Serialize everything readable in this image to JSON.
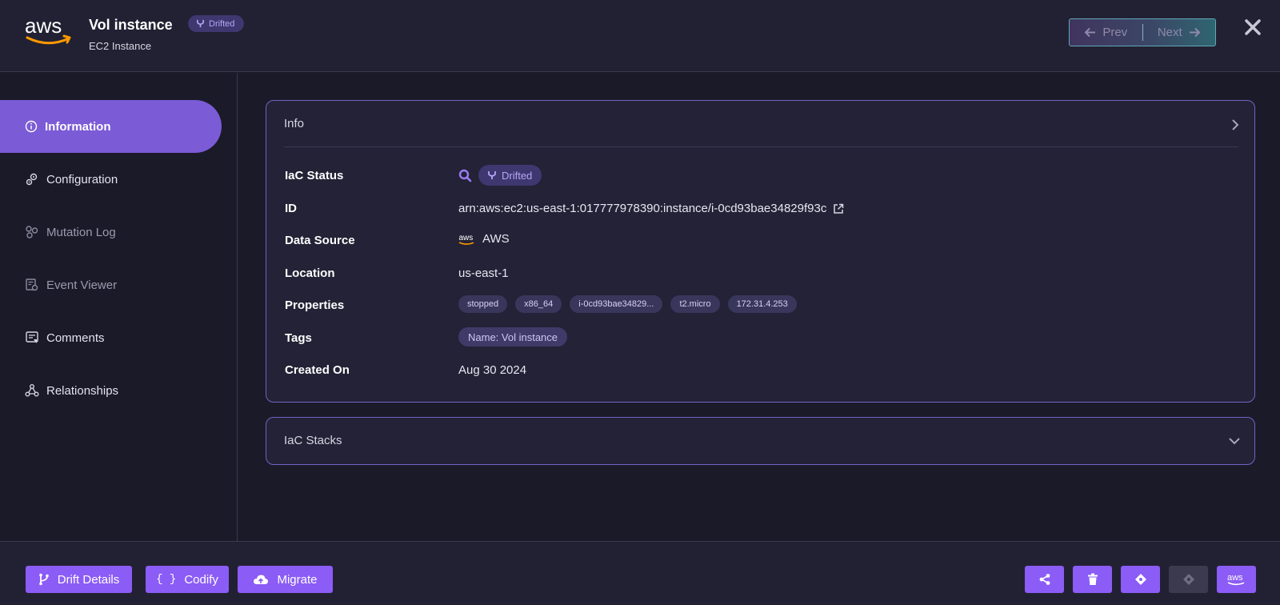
{
  "header": {
    "logo_text": "aws",
    "title": "Vol instance",
    "status_badge": "Drifted",
    "subtitle": "EC2 Instance",
    "prev_label": "Prev",
    "next_label": "Next",
    "close_icon": "close-icon"
  },
  "sidebar": {
    "items": [
      {
        "label": "Information",
        "icon": "info-icon",
        "state": "active"
      },
      {
        "label": "Configuration",
        "icon": "gears-icon",
        "state": "normal"
      },
      {
        "label": "Mutation Log",
        "icon": "mutation-log-icon",
        "state": "disabled"
      },
      {
        "label": "Event Viewer",
        "icon": "event-viewer-icon",
        "state": "disabled"
      },
      {
        "label": "Comments",
        "icon": "comments-icon",
        "state": "normal"
      },
      {
        "label": "Relationships",
        "icon": "relationships-icon",
        "state": "normal"
      }
    ]
  },
  "info": {
    "heading": "Info",
    "rows": {
      "iac_status": {
        "label": "IaC Status",
        "value": "Drifted"
      },
      "id": {
        "label": "ID",
        "value": "arn:aws:ec2:us-east-1:017777978390:instance/i-0cd93bae34829f93c"
      },
      "data_source": {
        "label": "Data Source",
        "logo_text": "aws",
        "value": "AWS"
      },
      "location": {
        "label": "Location",
        "value": "us-east-1"
      },
      "properties": {
        "label": "Properties",
        "values": [
          "stopped",
          "x86_64",
          "i-0cd93bae34829...",
          "t2.micro",
          "172.31.4.253"
        ]
      },
      "tags": {
        "label": "Tags",
        "values": [
          "Name: Vol instance"
        ]
      },
      "created_on": {
        "label": "Created On",
        "value": "Aug 30 2024"
      }
    }
  },
  "stacks": {
    "heading": "IaC Stacks"
  },
  "footer": {
    "drift_details": "Drift Details",
    "codify_symbol": "{ }",
    "codify": "Codify",
    "migrate": "Migrate",
    "aws_button_text": "aws"
  },
  "colors": {
    "accent": "#8b5cf6",
    "active_nav": "#7b5bd6",
    "card_border": "#7063c6",
    "background": "#1b1a28",
    "panel": "#222133"
  }
}
